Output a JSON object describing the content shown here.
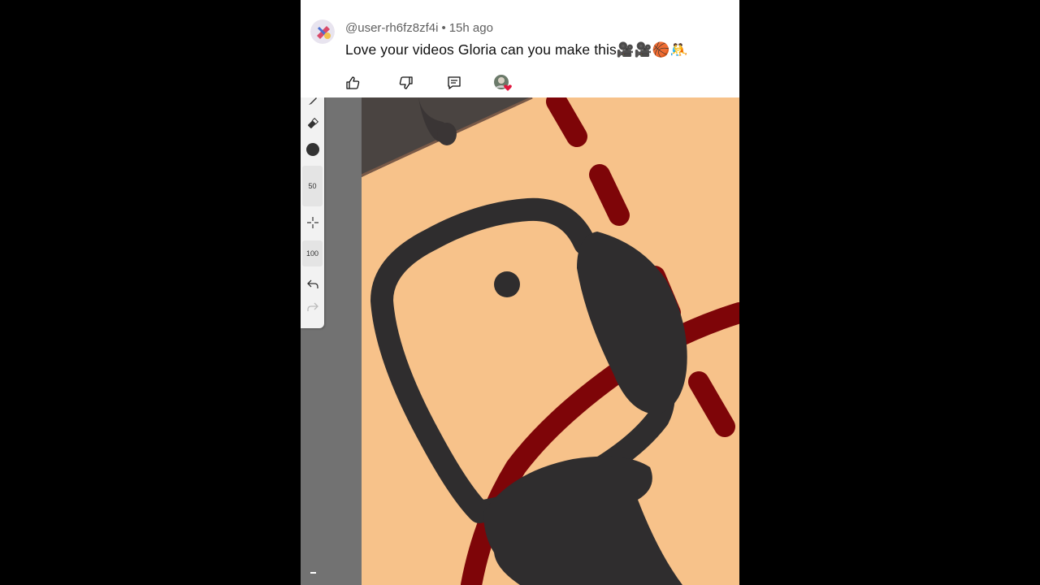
{
  "comment": {
    "username": "@user-rh6fz8zf4i",
    "separator": "•",
    "time_ago": "15h ago",
    "text": "Love your videos Gloria can you make this🎥🎥🏀🤼",
    "actions": [
      "like-icon",
      "dislike-icon",
      "reply-icon",
      "creator-heart-avatar"
    ]
  },
  "toolbar": {
    "tools": [
      "brush-icon",
      "eraser-icon",
      "color-swatch-icon",
      "size-slider",
      "move-icon",
      "opacity-slider",
      "undo-icon",
      "redo-icon"
    ],
    "brush_size": "50",
    "opacity": "100"
  },
  "colors": {
    "canvas": "#f7c28a",
    "outline": "#2f2d2e",
    "red_stroke": "#7e0508",
    "gray_panel": "#727272",
    "toolbar_bg": "#f2f2f2"
  }
}
